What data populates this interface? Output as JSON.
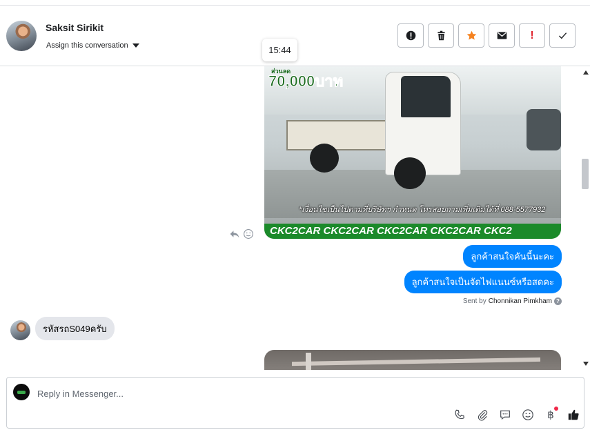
{
  "header": {
    "name": "Saksit Sirikit",
    "assign_label": "Assign this conversation",
    "actions": [
      {
        "icon": "alert-circle-icon"
      },
      {
        "icon": "trash-icon"
      },
      {
        "icon": "star-icon",
        "color": "#f5821f"
      },
      {
        "icon": "envelope-icon"
      },
      {
        "icon": "exclamation-icon",
        "label": "!",
        "color": "#e0242e"
      },
      {
        "icon": "checkmark-icon"
      }
    ]
  },
  "tooltip": {
    "time": "15:44"
  },
  "messages": {
    "image1": {
      "promo_small": "ส่วนลด",
      "promo": "70,000บาท",
      "caption": "*เงื่อนไขเป็นไปตามที่บริษัทฯ กำหนด โทรสอบถามเพิ่มเติมได้ที่ 088-5577932",
      "band": "CKC2CAR CKC2CAR CKC2CAR CKC2CAR CKC2"
    },
    "outgoing": [
      "ลูกค้าสนใจคันนี้นะคะ",
      "ลูกค้าสนใจเป็นจัดไฟแนนซ์หรือสดคะ"
    ],
    "sent_by_prefix": "Sent by",
    "sent_by_name": "Chonnikan Pimkham",
    "help_label": "?",
    "incoming": "รหัสรถS049ครับ"
  },
  "composer": {
    "placeholder": "Reply in Messenger...",
    "currency_symbol": "฿",
    "accent_color": "#0084ff"
  }
}
